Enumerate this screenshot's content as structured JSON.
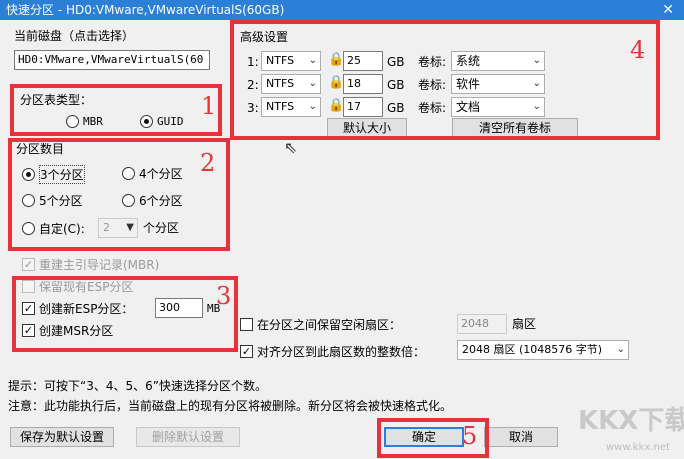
{
  "window": {
    "title": "快速分区 - HD0:VMware,VMwareVirtualS(60GB)",
    "close_glyph": "✕"
  },
  "disk": {
    "label": "当前磁盘（点击选择）",
    "value": "HD0:VMware,VMwareVirtualS(60"
  },
  "ptype": {
    "label": "分区表类型：",
    "mbr": "MBR",
    "guid": "GUID"
  },
  "count": {
    "label": "分区数目",
    "opt3": "3个分区",
    "opt4": "4个分区",
    "opt5": "5个分区",
    "opt6": "6个分区",
    "custom": "自定(C):",
    "custom_value": "2",
    "unit": "个分区"
  },
  "opts": {
    "rebuild_mbr": "重建主引导记录(MBR)",
    "keep_esp": "保留现有ESP分区",
    "create_esp": "创建新ESP分区：",
    "esp_size": "300",
    "esp_unit": "MB",
    "create_msr": "创建MSR分区"
  },
  "advanced": {
    "label": "高级设置",
    "vol_label": "卷标:",
    "size_unit": "GB",
    "rows": [
      {
        "index": "1:",
        "fs": "NTFS",
        "size": "25",
        "volume": "系统"
      },
      {
        "index": "2:",
        "fs": "NTFS",
        "size": "18",
        "volume": "软件"
      },
      {
        "index": "3:",
        "fs": "NTFS",
        "size": "17",
        "volume": "文档"
      }
    ],
    "default_size_button": "默认大小",
    "clear_labels_button": "清空所有卷标"
  },
  "align": {
    "reserve_label": "在分区之间保留空闲扇区：",
    "reserve_value": "2048",
    "reserve_unit": "扇区",
    "align_label": "对齐分区到此扇区数的整数倍：",
    "align_value": "2048 扇区 (1048576 字节)"
  },
  "tips": {
    "line1": "提示：可按下“3、4、5、6”快速选择分区个数。",
    "line2": "注意：此功能执行后，当前磁盘上的现有分区将被删除。新分区将会被快速格式化。"
  },
  "buttons": {
    "save_default": "保存为默认设置",
    "delete_default": "删除默认设置",
    "ok": "确定",
    "cancel": "取消"
  },
  "annotations": {
    "n1": "1",
    "n2": "2",
    "n3": "3",
    "n4": "4",
    "n5": "5"
  },
  "watermark": {
    "text": "KKX下载",
    "url": "www.kkx.net"
  },
  "colors": {
    "annotation_red": "#e6323b",
    "titlebar_blue": "#2b7fd7"
  }
}
